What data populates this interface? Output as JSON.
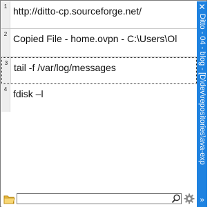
{
  "clips": [
    {
      "index": "1",
      "text": "http://ditto-cp.sourceforge.net/"
    },
    {
      "index": "2",
      "text": "Copied File - home.ovpn - C:\\Users\\Ol"
    },
    {
      "index": "3",
      "text": "tail -f /var/log/messages"
    },
    {
      "index": "4",
      "text": "fdisk –l"
    }
  ],
  "sidebar": {
    "close_glyph": "✕",
    "title": "Ditto - 04 - blog - [D\\dev\\repositories\\ava-exp",
    "expand_glyph": "»",
    "color": "#1e82e0"
  },
  "search": {
    "value": "",
    "placeholder": ""
  },
  "icons": {
    "folder": "folder-icon",
    "search": "search-icon",
    "settings": "gear-icon"
  }
}
